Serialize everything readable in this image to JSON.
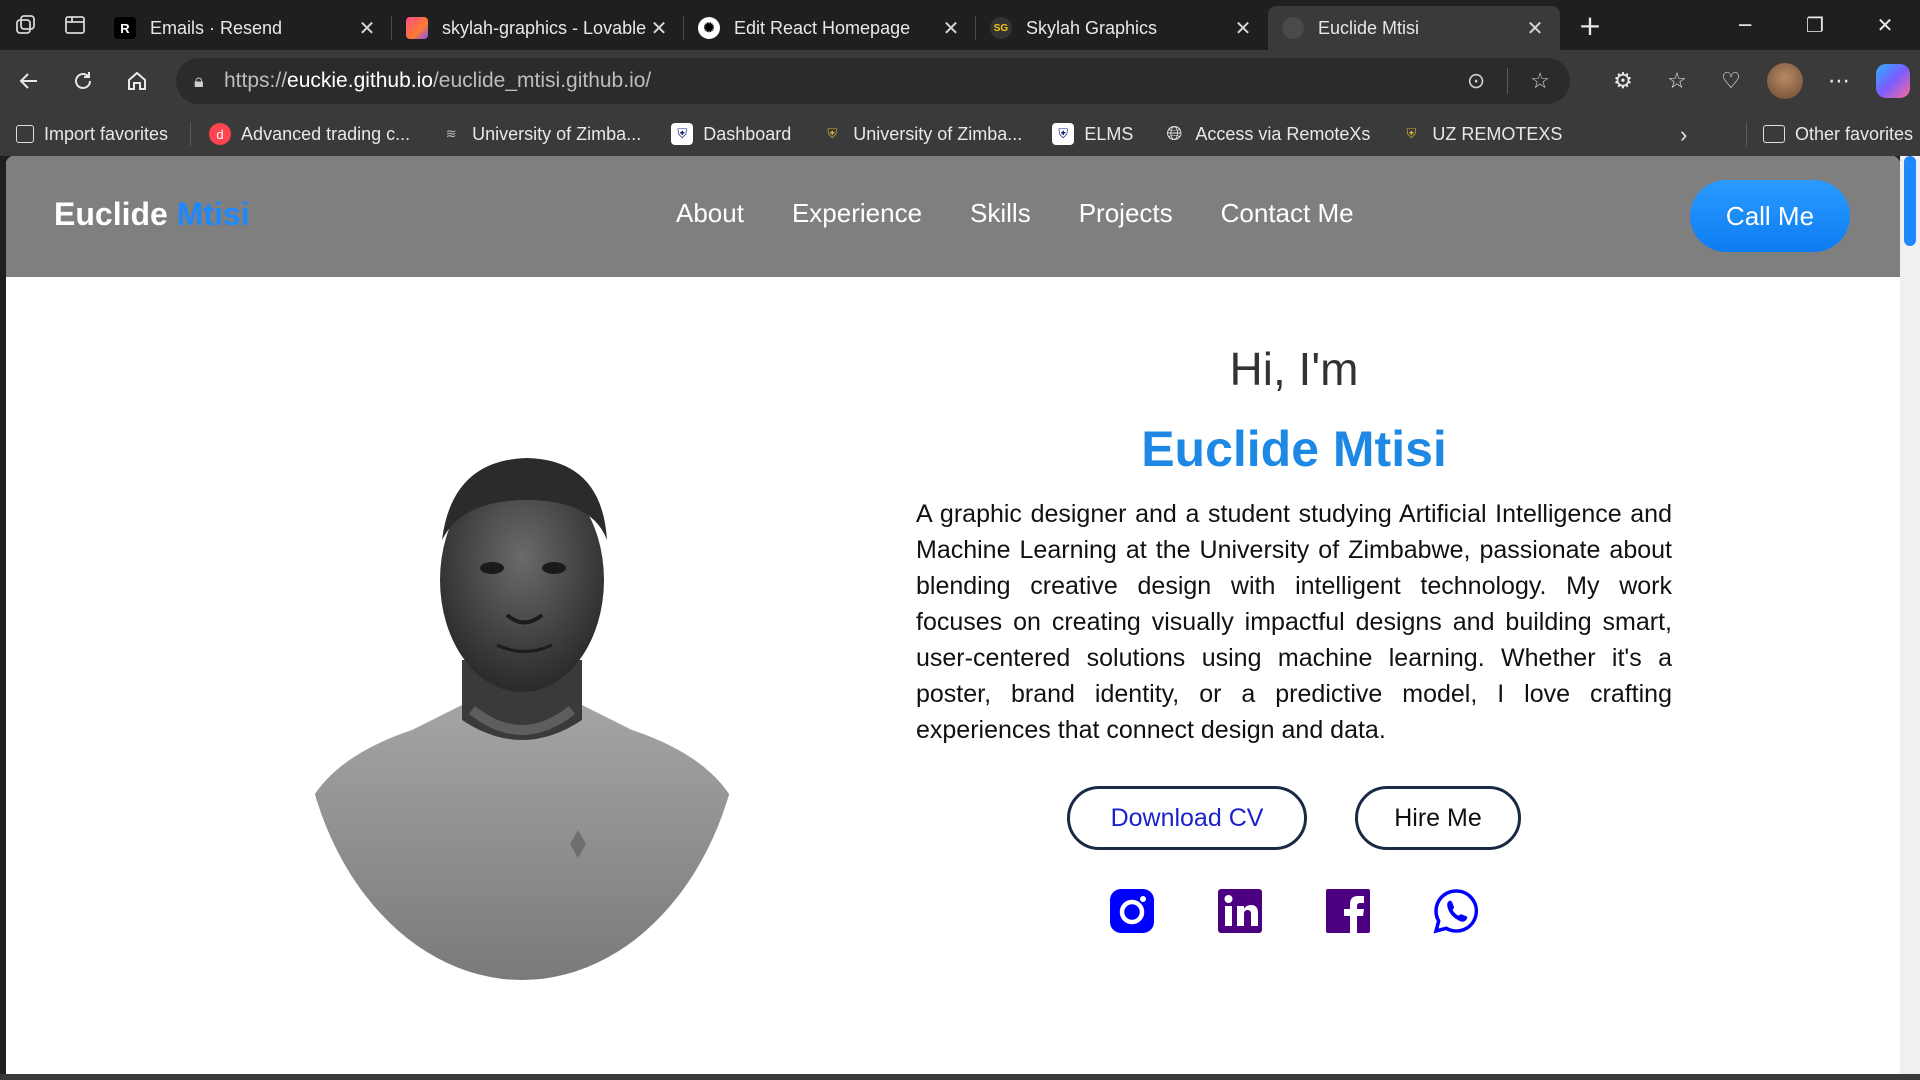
{
  "browser": {
    "tabs": [
      {
        "title": "Emails · Resend",
        "favicon": "R"
      },
      {
        "title": "skylah-graphics - Lovable",
        "favicon": "lovable-icon"
      },
      {
        "title": "Edit React Homepage",
        "favicon": "chatgpt-icon"
      },
      {
        "title": "Skylah Graphics",
        "favicon": "skylah-icon"
      },
      {
        "title": "Euclide Mtisi",
        "favicon": "site-icon",
        "active": true
      }
    ],
    "address": {
      "prefix": "https://",
      "host": "euckie.github.io",
      "path": "/euclide_mtisi.github.io/"
    },
    "bookmarks": [
      {
        "label": "Import favorites"
      },
      {
        "label": "Advanced trading c..."
      },
      {
        "label": "University of Zimba..."
      },
      {
        "label": "Dashboard"
      },
      {
        "label": "University of Zimba..."
      },
      {
        "label": "ELMS"
      },
      {
        "label": "Access via RemoteXs"
      },
      {
        "label": "UZ REMOTEXS"
      }
    ],
    "other_favorites": "Other favorites"
  },
  "site": {
    "logo_first": "Euclide",
    "logo_second": "Mtisi",
    "nav": [
      "About",
      "Experience",
      "Skills",
      "Projects",
      "Contact Me"
    ],
    "call_button": "Call Me",
    "hero": {
      "greeting": "Hi, I'm",
      "name": "Euclide Mtisi",
      "bio": "A graphic designer and a student studying Artificial Intelligence and Machine Learning at the University of Zimbabwe, passionate about blending creative design with intelligent technology. My work focuses on creating visually impactful designs and building smart, user-centered solutions using machine learning. Whether it's a poster, brand identity, or a predictive model, I love crafting experiences that connect design and data.",
      "download_cv": "Download CV",
      "hire_me": "Hire Me"
    },
    "socials": [
      "instagram-icon",
      "linkedin-icon",
      "facebook-icon",
      "whatsapp-icon"
    ],
    "colors": {
      "accent": "#1e88e5",
      "nav_bg": "#7f7f7f",
      "instagram": "#0000ff",
      "linkedin": "#4b0082",
      "facebook": "#4b0082",
      "whatsapp": "#0000ff"
    }
  }
}
